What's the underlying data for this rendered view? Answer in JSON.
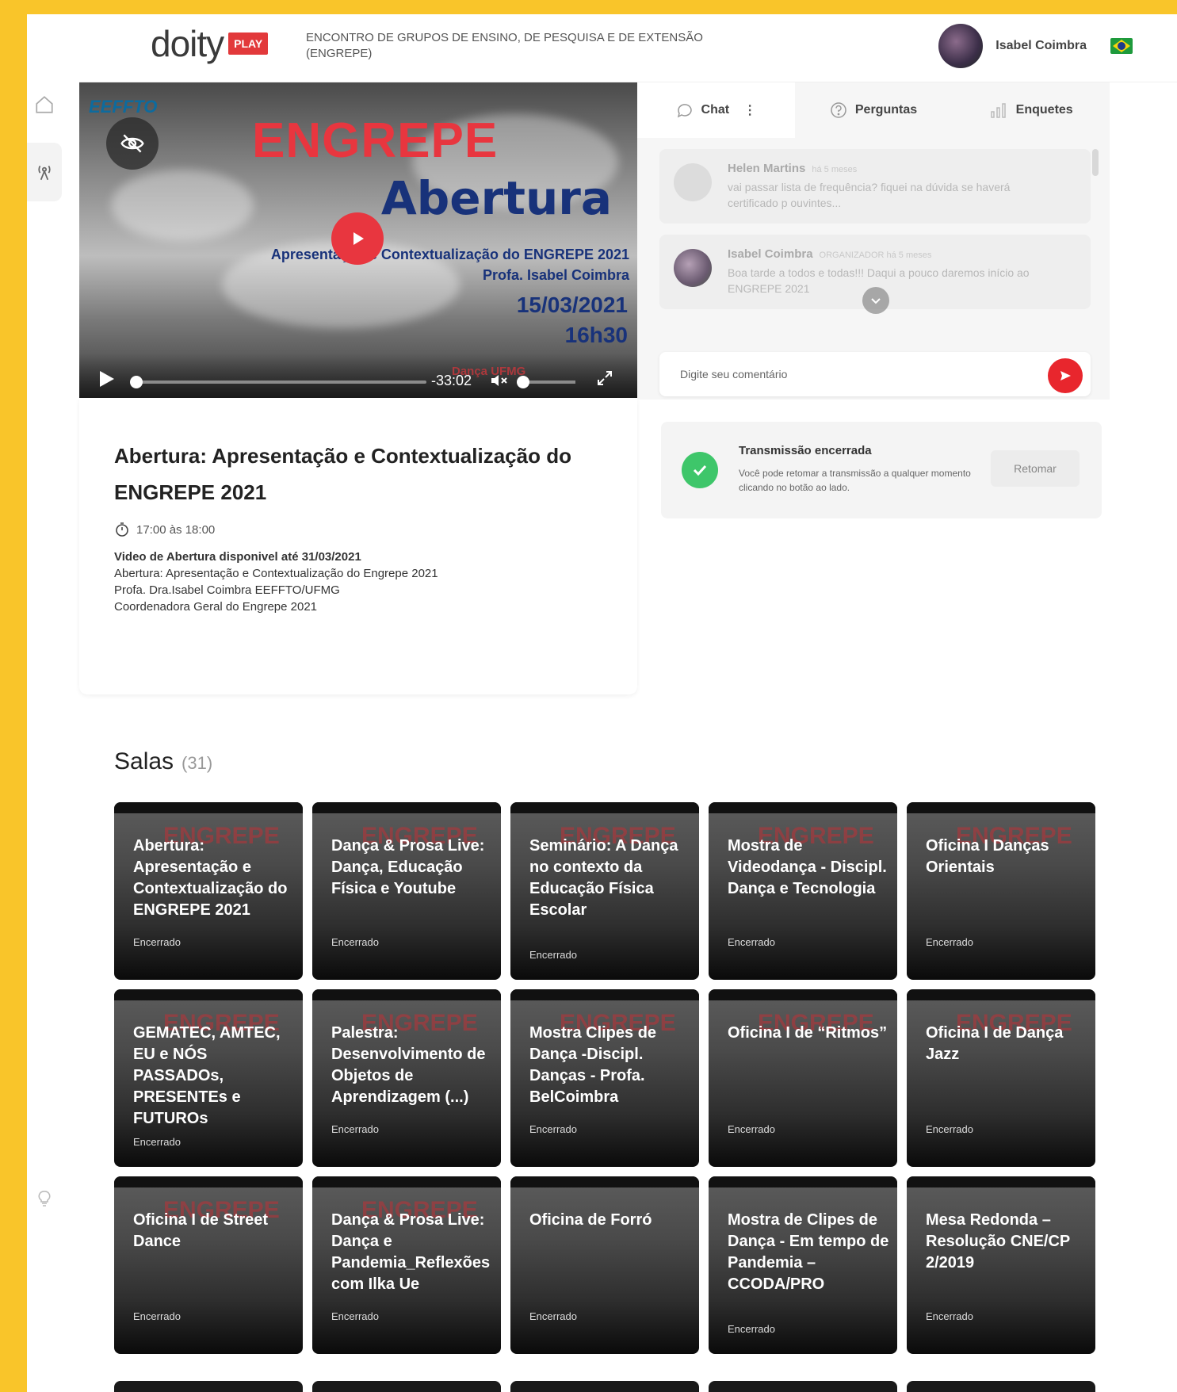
{
  "header": {
    "logo_text": "doity",
    "logo_badge": "PLAY",
    "event_name": "ENCONTRO DE GRUPOS DE ENSINO, DE PESQUISA E DE EXTENSÃO (ENGREPE)",
    "user_name": "Isabel Coimbra"
  },
  "video": {
    "logo_text": "EEFFTO",
    "title": "ENGREPE",
    "subtitle": "Abertura",
    "desc_line1": "Apresentação e Contextualização do ENGREPE 2021",
    "desc_line2": "Profa. Isabel Coimbra",
    "date": "15/03/2021",
    "hour": "16h30",
    "time_remaining": "-33:02",
    "footer_logos": "Dança   UFMG",
    "progress": 0.0,
    "volume": 0.0
  },
  "session": {
    "title": "Abertura: Apresentação e Contextualização do ENGREPE 2021",
    "time": "17:00 às 18:00",
    "desc_bold": "Video de Abertura disponivel até 31/03/2021",
    "desc_line1": "Abertura: Apresentação e Contextualização do Engrepe 2021",
    "desc_line2": "Profa. Dra.Isabel Coimbra EEFFTO/UFMG",
    "desc_line3": "Coordenadora Geral do Engrepe 2021"
  },
  "chat": {
    "tabs": [
      {
        "label": "Chat"
      },
      {
        "label": "Perguntas"
      },
      {
        "label": "Enquetes"
      }
    ],
    "messages": [
      {
        "name": "Helen Martins",
        "meta": "há 5 meses",
        "text": "vai passar lista de frequência? fiquei na dúvida se haverá certificado p ouvintes..."
      },
      {
        "name": "Isabel Coimbra",
        "meta": "ORGANIZADOR   há 5 meses",
        "text": "Boa tarde a todos e todas!!! Daqui a pouco daremos início ao ENGREPE 2021"
      }
    ],
    "comment_placeholder": "Digite seu comentário"
  },
  "transmission": {
    "title": "Transmissão encerrada",
    "text": "Você pode retomar a transmissão a qualquer momento clicando no botão ao lado.",
    "button": "Retomar"
  },
  "salas": {
    "title": "Salas",
    "count": "(31)",
    "watermark": "ENGREPE",
    "cards": [
      {
        "title": "Abertura: Apresentação e Contextualização do ENGREPE 2021",
        "status": "Encerrado"
      },
      {
        "title": "Dança & Prosa Live: Dança, Educação Física e Youtube",
        "status": "Encerrado"
      },
      {
        "title": "Seminário: A Dança no contexto da Educação Física Escolar",
        "status": "Encerrado"
      },
      {
        "title": "Mostra de Videodança - Discipl. Dança e Tecnologia",
        "status": "Encerrado"
      },
      {
        "title": "Oficina I Danças Orientais",
        "status": "Encerrado"
      },
      {
        "title": "GEMATEC, AMTEC, EU e NÓS PASSADOs, PRESENTEs e FUTUROs",
        "status": "Encerrado"
      },
      {
        "title": "Palestra: Desenvolvimento de Objetos de Aprendizagem (...)",
        "status": "Encerrado"
      },
      {
        "title": "Mostra Clipes de Dança -Discipl. Danças - Profa. BelCoimbra",
        "status": "Encerrado"
      },
      {
        "title": "Oficina I de “Ritmos”",
        "status": "Encerrado"
      },
      {
        "title": "Oficina I de Dança Jazz",
        "status": "Encerrado"
      },
      {
        "title": "Oficina I de Street Dance",
        "status": "Encerrado"
      },
      {
        "title": "Dança & Prosa Live: Dança e Pandemia_Reflexões com Ilka Ue",
        "status": "Encerrado"
      },
      {
        "title": "Oficina de Forró",
        "status": "Encerrado"
      },
      {
        "title": "Mostra de Clipes de Dança - Em tempo de Pandemia – CCODA/PRO",
        "status": "Encerrado"
      },
      {
        "title": "Mesa Redonda – Resolução CNE/CP 2/2019",
        "status": "Encerrado"
      }
    ]
  }
}
